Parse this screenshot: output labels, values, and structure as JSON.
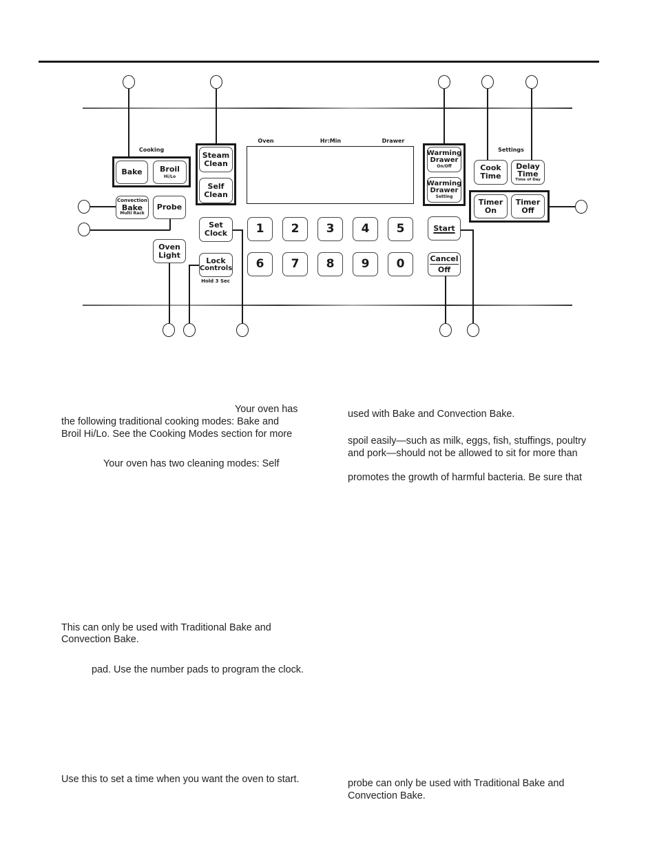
{
  "panel": {
    "labels": {
      "cooking": "Cooking",
      "settings": "Settings",
      "oven": "Oven",
      "hr_min": "Hr:Min",
      "drawer": "Drawer",
      "hold": "Hold 3 Sec"
    },
    "keys": {
      "bake": {
        "main": "Bake"
      },
      "broil": {
        "main": "Broil",
        "sub": "Hi/Lo"
      },
      "convection_bake": {
        "top": "Convection",
        "main": "Bake",
        "sub": "Multi Rack"
      },
      "probe": {
        "main": "Probe"
      },
      "oven_light": {
        "line1": "Oven",
        "line2": "Light"
      },
      "steam_clean": {
        "line1": "Steam",
        "line2": "Clean"
      },
      "self_clean": {
        "line1": "Self",
        "line2": "Clean"
      },
      "set_clock": {
        "line1": "Set",
        "line2": "Clock"
      },
      "lock_controls": {
        "line1": "Lock",
        "line2": "Controls"
      },
      "warming_drawer_onoff": {
        "line1": "Warming",
        "line2": "Drawer",
        "sub": "On/Off"
      },
      "warming_drawer_setting": {
        "line1": "Warming",
        "line2": "Drawer",
        "sub": "Setting"
      },
      "cook_time": {
        "line1": "Cook",
        "line2": "Time"
      },
      "delay_time": {
        "line1": "Delay",
        "line2": "Time",
        "sub": "Time of Day"
      },
      "timer_on": {
        "line1": "Timer",
        "line2": "On"
      },
      "timer_off": {
        "line1": "Timer",
        "line2": "Off"
      },
      "start": {
        "main": "Start"
      },
      "cancel_off": {
        "line1": "Cancel",
        "line2": "Off"
      }
    },
    "number_keys": [
      "1",
      "2",
      "3",
      "4",
      "5",
      "6",
      "7",
      "8",
      "9",
      "0"
    ]
  },
  "text": {
    "left": [
      "Your oven has",
      "the following traditional cooking modes: Bake and",
      "Broil Hi/Lo. See the Cooking Modes section for more",
      "Your oven has two cleaning modes: Self",
      "This can only be used with Traditional Bake and",
      "Convection Bake.",
      "pad. Use the number pads to program the clock.",
      "Use this to set a time when you want the oven to start."
    ],
    "right": [
      "used with Bake and Convection Bake.",
      "spoil easily—such as milk, eggs, fish, stuffings, poultry",
      "and pork—should not be allowed to sit for more than",
      "promotes the growth of harmful bacteria. Be sure that",
      "probe can only be used with Traditional Bake and",
      "Convection Bake."
    ]
  }
}
